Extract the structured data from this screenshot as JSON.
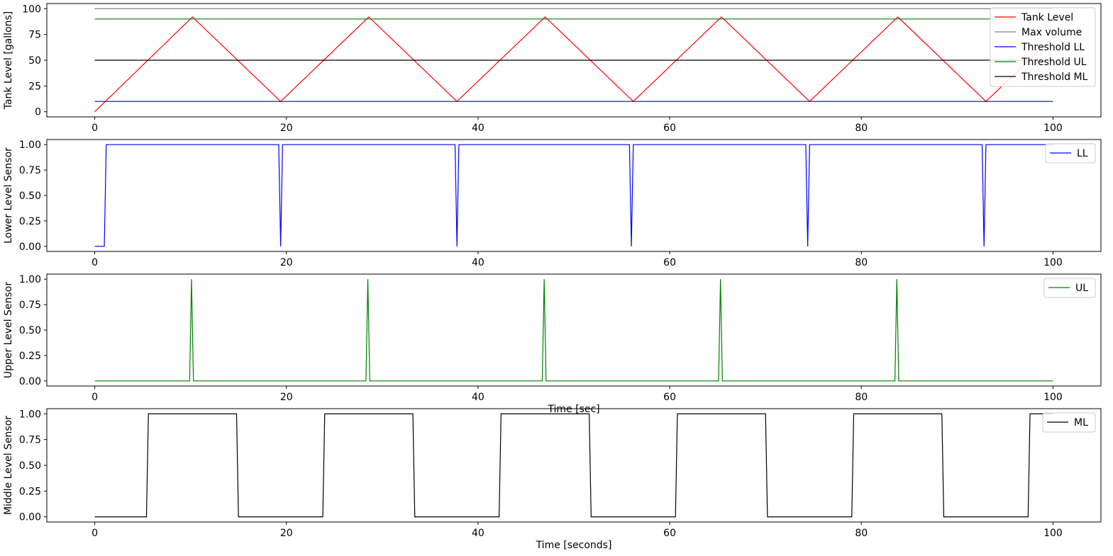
{
  "chart_data": [
    {
      "type": "line",
      "title": "",
      "xlabel": "",
      "ylabel": "Tank Level [gallons]",
      "xlim": [
        -5,
        105
      ],
      "ylim": [
        -5,
        105
      ],
      "xticks": [
        0,
        20,
        40,
        60,
        80,
        100
      ],
      "yticks": [
        0,
        25,
        50,
        75,
        100
      ],
      "ytick_labels": [
        "0",
        "25",
        "50",
        "75",
        "100"
      ],
      "grid": false,
      "legend_position": "top-right",
      "series": [
        {
          "name": "Tank Level",
          "color": "#ff0000",
          "x": [
            0,
            10.2,
            19.4,
            28.6,
            37.8,
            47.0,
            56.2,
            65.4,
            74.6,
            83.8,
            93.0,
            100.0
          ],
          "y": [
            0,
            92,
            10,
            92,
            10,
            92,
            10,
            92,
            10,
            92,
            10,
            72
          ]
        },
        {
          "name": "Max volume",
          "color": "#808080",
          "x": [
            0,
            100
          ],
          "y": [
            100,
            100
          ]
        },
        {
          "name": "Threshold LL",
          "color": "#0000ff",
          "x": [
            0,
            100
          ],
          "y": [
            10,
            10
          ]
        },
        {
          "name": "Threshold UL",
          "color": "#008000",
          "x": [
            0,
            100
          ],
          "y": [
            90,
            90
          ]
        },
        {
          "name": "Threshold ML",
          "color": "#000000",
          "x": [
            0,
            100
          ],
          "y": [
            50,
            50
          ]
        }
      ]
    },
    {
      "type": "line",
      "title": "",
      "xlabel": "",
      "ylabel": "Lower Level Sensor",
      "xlim": [
        -5,
        105
      ],
      "ylim": [
        -0.05,
        1.05
      ],
      "xticks": [
        0,
        20,
        40,
        60,
        80,
        100
      ],
      "yticks": [
        0,
        0.25,
        0.5,
        0.75,
        1.0
      ],
      "ytick_labels": [
        "0.00",
        "0.25",
        "0.50",
        "0.75",
        "1.00"
      ],
      "grid": false,
      "legend_position": "top-right",
      "series": [
        {
          "name": "LL",
          "color": "#0000ff",
          "x": [
            0,
            1.0,
            1.2,
            19.2,
            19.4,
            19.6,
            37.6,
            37.8,
            38.0,
            55.8,
            56.0,
            56.2,
            74.2,
            74.4,
            74.6,
            92.6,
            92.8,
            93.0,
            100.0
          ],
          "y": [
            0,
            0,
            1,
            1,
            0,
            1,
            1,
            0,
            1,
            1,
            0,
            1,
            1,
            0,
            1,
            1,
            0,
            1,
            1
          ]
        }
      ]
    },
    {
      "type": "line",
      "title": "",
      "xlabel": "Time [sec]",
      "ylabel": "Upper Level Sensor",
      "xlim": [
        -5,
        105
      ],
      "ylim": [
        -0.05,
        1.05
      ],
      "xticks": [
        0,
        20,
        40,
        60,
        80,
        100
      ],
      "yticks": [
        0,
        0.25,
        0.5,
        0.75,
        1.0
      ],
      "ytick_labels": [
        "0.00",
        "0.25",
        "0.50",
        "0.75",
        "1.00"
      ],
      "grid": false,
      "legend_position": "top-right",
      "series": [
        {
          "name": "UL",
          "color": "#008000",
          "x": [
            0,
            9.9,
            10.1,
            10.3,
            28.3,
            28.5,
            28.7,
            46.7,
            46.9,
            47.1,
            65.1,
            65.3,
            65.5,
            83.5,
            83.7,
            83.9,
            100.0
          ],
          "y": [
            0,
            0,
            1,
            0,
            0,
            1,
            0,
            0,
            1,
            0,
            0,
            1,
            0,
            0,
            1,
            0,
            0
          ]
        }
      ]
    },
    {
      "type": "line",
      "title": "",
      "xlabel": "Time [seconds]",
      "ylabel": "Middle Level Sensor",
      "xlim": [
        -5,
        105
      ],
      "ylim": [
        -0.05,
        1.05
      ],
      "xticks": [
        0,
        20,
        40,
        60,
        80,
        100
      ],
      "yticks": [
        0,
        0.25,
        0.5,
        0.75,
        1.0
      ],
      "ytick_labels": [
        "0.00",
        "0.25",
        "0.50",
        "0.75",
        "1.00"
      ],
      "grid": false,
      "legend_position": "top-right",
      "series": [
        {
          "name": "ML",
          "color": "#000000",
          "x": [
            0,
            5.4,
            5.6,
            14.8,
            15.0,
            23.8,
            24.0,
            33.2,
            33.4,
            42.2,
            42.4,
            51.6,
            51.8,
            60.6,
            60.8,
            70.0,
            70.2,
            79.0,
            79.2,
            88.4,
            88.6,
            97.4,
            97.6,
            100.0
          ],
          "y": [
            0,
            0,
            1,
            1,
            0,
            0,
            1,
            1,
            0,
            0,
            1,
            1,
            0,
            0,
            1,
            1,
            0,
            0,
            1,
            1,
            0,
            0,
            1,
            1
          ]
        }
      ]
    }
  ]
}
